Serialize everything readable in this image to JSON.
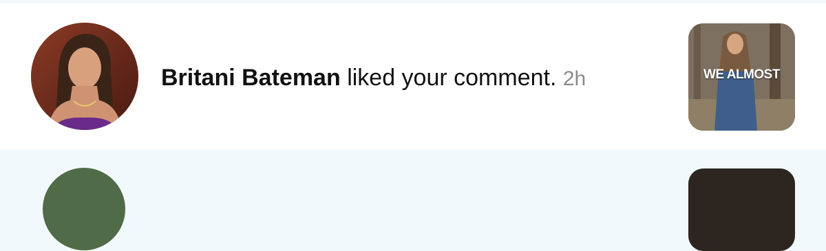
{
  "notifications": [
    {
      "username": "Britani Bateman",
      "action": "liked your comment.",
      "time": "2h",
      "thumbnail_caption": "WE ALMOST",
      "avatar_icon": "user-avatar-photo",
      "thumbnail_icon": "video-thumbnail"
    }
  ],
  "colors": {
    "list_background": "#f2f9fd",
    "row_background": "#ffffff",
    "text_primary": "#111111",
    "text_secondary": "#8a8a8a"
  }
}
